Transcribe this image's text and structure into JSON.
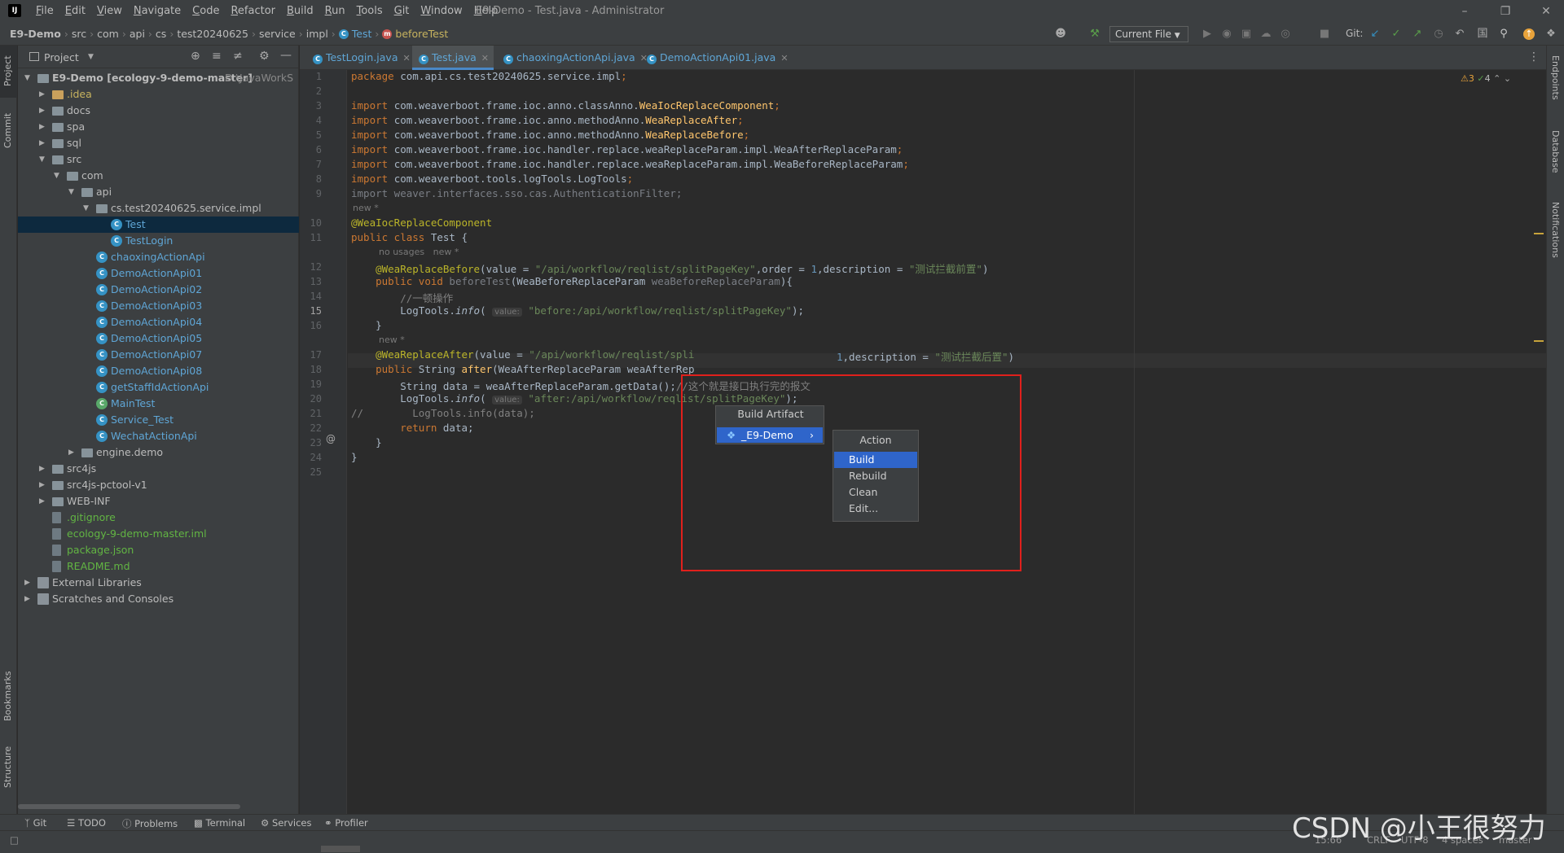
{
  "window": {
    "title": "E9-Demo - Test.java - Administrator",
    "menu": [
      "File",
      "Edit",
      "View",
      "Navigate",
      "Code",
      "Refactor",
      "Build",
      "Run",
      "Tools",
      "Git",
      "Window",
      "Help"
    ]
  },
  "breadcrumb": [
    "E9-Demo",
    "src",
    "com",
    "api",
    "cs",
    "test20240625",
    "service",
    "impl",
    "Test",
    "beforeTest"
  ],
  "toolbar": {
    "run_config": "Current File",
    "git_label": "Git:"
  },
  "left_strip": {
    "project": "Project",
    "commit": "Commit",
    "bookmarks": "Bookmarks",
    "structure": "Structure"
  },
  "right_strip": {
    "endpoints": "Endpoints",
    "database": "Database",
    "notifications": "Notifications"
  },
  "project": {
    "title": "Project",
    "tree": [
      {
        "label": "E9-Demo [ecology-9-demo-master]",
        "extra": "D:\\JavaWorkS",
        "type": "folder"
      },
      {
        "label": ".idea",
        "type": "folder-orange"
      },
      {
        "label": "docs",
        "type": "folder"
      },
      {
        "label": "spa",
        "type": "folder"
      },
      {
        "label": "sql",
        "type": "folder"
      },
      {
        "label": "src",
        "type": "folder"
      },
      {
        "label": "com",
        "type": "folder"
      },
      {
        "label": "api",
        "type": "folder"
      },
      {
        "label": "cs.test20240625.service.impl",
        "type": "folder"
      },
      {
        "label": "Test",
        "type": "class"
      },
      {
        "label": "TestLogin",
        "type": "class"
      },
      {
        "label": "chaoxingActionApi",
        "type": "class"
      },
      {
        "label": "DemoActionApi01",
        "type": "class"
      },
      {
        "label": "DemoActionApi02",
        "type": "class"
      },
      {
        "label": "DemoActionApi03",
        "type": "class"
      },
      {
        "label": "DemoActionApi04",
        "type": "class"
      },
      {
        "label": "DemoActionApi05",
        "type": "class"
      },
      {
        "label": "DemoActionApi07",
        "type": "class"
      },
      {
        "label": "DemoActionApi08",
        "type": "class"
      },
      {
        "label": "getStaffIdActionApi",
        "type": "class"
      },
      {
        "label": "MainTest",
        "type": "class-green"
      },
      {
        "label": "Service_Test",
        "type": "class"
      },
      {
        "label": "WechatActionApi",
        "type": "class"
      },
      {
        "label": "engine.demo",
        "type": "folder"
      },
      {
        "label": "src4js",
        "type": "folder"
      },
      {
        "label": "src4js-pctool-v1",
        "type": "folder"
      },
      {
        "label": "WEB-INF",
        "type": "folder"
      },
      {
        "label": ".gitignore",
        "type": "file"
      },
      {
        "label": "ecology-9-demo-master.iml",
        "type": "file"
      },
      {
        "label": "package.json",
        "type": "file"
      },
      {
        "label": "README.md",
        "type": "file"
      },
      {
        "label": "External Libraries",
        "type": "lib"
      },
      {
        "label": "Scratches and Consoles",
        "type": "lib"
      }
    ]
  },
  "tabs": [
    "TestLogin.java",
    "Test.java",
    "chaoxingActionApi.java",
    "DemoActionApi01.java"
  ],
  "editor": {
    "inspections": {
      "warnings": "3",
      "weak": "4"
    },
    "hints": {
      "new": "new *",
      "no_usages": "no usages",
      "value": "value:"
    },
    "line_numbers": [
      "1",
      "2",
      "3",
      "4",
      "5",
      "6",
      "7",
      "8",
      "9",
      "10",
      "11",
      "12",
      "13",
      "14",
      "15",
      "16",
      "17",
      "18",
      "19",
      "20",
      "21",
      "22",
      "23",
      "24",
      "25"
    ],
    "lines": {
      "l1a": "package ",
      "l1b": "com.api.cs.test20240625.service.impl",
      "l1c": ";",
      "l3": "com.weaverboot.frame.ioc.anno.classAnno.",
      "l3b": "WeaIocReplaceComponent",
      "l4": "com.weaverboot.frame.ioc.anno.methodAnno.",
      "l4b": "WeaReplaceAfter",
      "l5": "com.weaverboot.frame.ioc.anno.methodAnno.",
      "l5b": "WeaReplaceBefore",
      "l6": "com.weaverboot.frame.ioc.handler.replace.weaReplaceParam.impl.WeaAfterReplaceParam",
      "l7": "com.weaverboot.frame.ioc.handler.replace.weaReplaceParam.impl.WeaBeforeReplaceParam",
      "l8": "com.weaverboot.tools.logTools.LogTools",
      "l9": "import weaver.interfaces.sso.cas.AuthenticationFilter;",
      "import_kw": "import ",
      "semi": ";",
      "l10": "@WeaIocReplaceComponent",
      "l11a": "public class ",
      "l11b": "Test {",
      "l12a": "@WeaReplaceBefore",
      "l12b": "(value = ",
      "l12c": "\"/api/workflow/reqlist/splitPageKey\"",
      "l12d": ",order = ",
      "l12e": "1",
      "l12f": ",description = ",
      "l12g": "\"测试拦截前置\"",
      "l12h": ")",
      "l13a": "public void ",
      "l13b": "beforeTest",
      "l13c": "(WeaBeforeReplaceParam ",
      "l13d": "weaBeforeReplaceParam",
      "l13e": "){",
      "l14": "//一顿操作",
      "l15a": "LogTools.",
      "l15b": "info",
      "l15c": "(",
      "l15d": "\"before:/api/workflow/reqlist/splitPageKey\"",
      "l15e": ");",
      "l16": "}",
      "l17a": "@WeaReplaceAfter",
      "l17b": "(value = ",
      "l17c": "\"/api/workflow/reqlist/spli",
      "l17d": "1",
      "l17e": ",description = ",
      "l17f": "\"测试拦截后置\"",
      "l17g": ")",
      "l18a": "public ",
      "l18b": "String ",
      "l18c": "after",
      "l18d": "(WeaAfterReplaceParam weaAfterRep",
      "l19a": "String data = weaAfterReplaceParam.getData",
      "l19b": "();",
      "l19c": "//这个就是接口执行完的报文",
      "l20a": "LogTools.",
      "l20b": "info",
      "l20c": "(",
      "l20d": "\"after:/api/workflow/reqlist/splitPageKey\"",
      "l20e": ");",
      "l21": "//        LogTools.info(data);",
      "l22a": "return ",
      "l22b": "data;",
      "l23": "}",
      "l24": "}"
    }
  },
  "popup": {
    "menu1_title": "Build Artifact",
    "menu1_item": "_E9-Demo",
    "menu2_title": "Action",
    "menu2_items": [
      "Build",
      "Rebuild",
      "Clean",
      "Edit..."
    ]
  },
  "bottom_tools": [
    "Git",
    "TODO",
    "Problems",
    "Terminal",
    "Services",
    "Profiler"
  ],
  "status": {
    "position": "15:66",
    "line_sep": "CRLF",
    "encoding": "UTF-8",
    "indent": "4 spaces",
    "branch": "master"
  },
  "watermark": "CSDN @小王很努力"
}
